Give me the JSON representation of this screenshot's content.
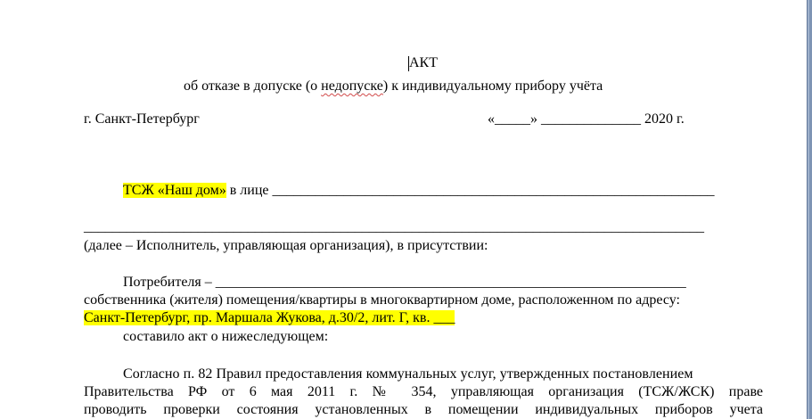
{
  "doc": {
    "title": "АКТ",
    "subtitle_before": "об отказе в допуске (о ",
    "subtitle_flagged_word": "недопуске",
    "subtitle_after": ") к индивидуальному прибору учёта",
    "city": "г. Санкт-Петербург",
    "date_line": "«_____» ______________ 2020 г.",
    "org_name": "ТСЖ «Наш дом»",
    "in_person_of": " в лице ______________________________________________________________",
    "blank_full_line": "_______________________________________________________________________________________",
    "executor_note": "(далее – Исполнитель, управляющая организация), в присутствии:",
    "consumer_line": "Потребителя – __________________________________________________________________",
    "owner_line": "собственника (жителя) помещения/квартиры в многоквартирном доме, расположенном по адресу:",
    "address": "Санкт-Петербург, пр. Маршала Жукова, д.30/2, лит. Г, кв. ___",
    "drew_up": "составило акт о нижеследующем:",
    "para_line1": "Согласно п. 82 Правил предоставления коммунальных услуг, утвержденных постановлением",
    "para_line2": "Правительства РФ от 6 мая 2011 г. № 354, управляющая организация (ТСЖ/ЖСК) праве",
    "para_line3": "проводить проверки состояния установленных в помещении индивидуальных приборов учета"
  },
  "colors": {
    "highlight": "#ffff00",
    "spellcheck": "#d24b4b",
    "workspace": "#7e94b4"
  }
}
